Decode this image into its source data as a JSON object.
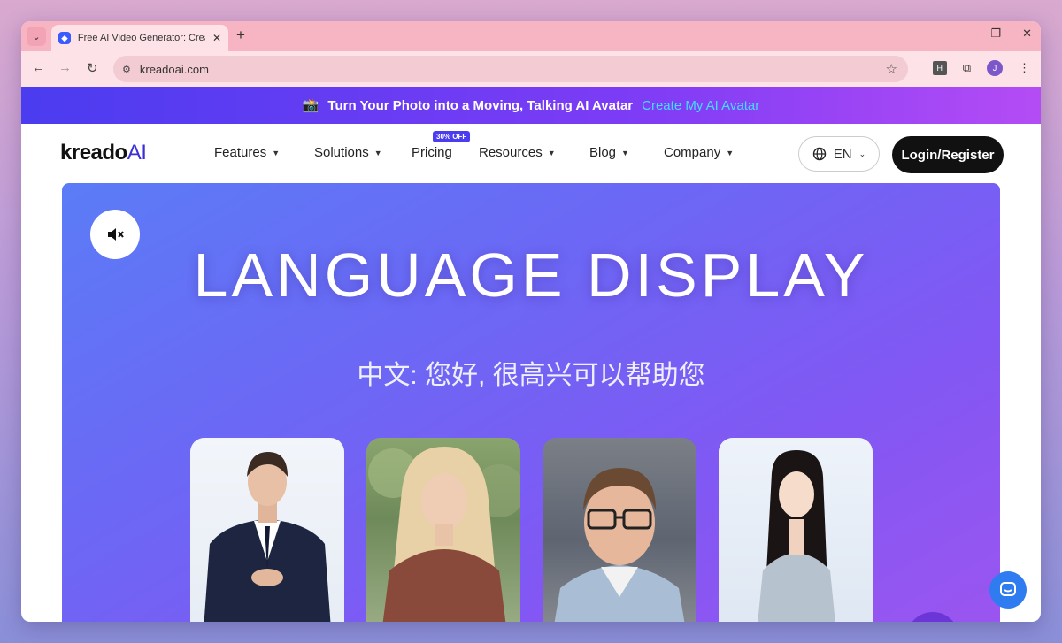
{
  "browser": {
    "tab_title": "Free AI Video Generator: Create",
    "favicon": "kreado-favicon",
    "url": "kreadoai.com",
    "profile_initial": "J",
    "ext_h": "H"
  },
  "banner": {
    "emoji": "📸",
    "text": "Turn Your Photo into a Moving, Talking AI Avatar",
    "link": "Create My AI Avatar"
  },
  "nav": {
    "logo_main": "kreado",
    "logo_ai": "AI",
    "items": [
      {
        "label": "Features",
        "dropdown": true
      },
      {
        "label": "Solutions",
        "dropdown": true
      },
      {
        "label": "Pricing",
        "dropdown": false,
        "badge": "30% OFF"
      },
      {
        "label": "Resources",
        "dropdown": true
      },
      {
        "label": "Blog",
        "dropdown": true
      },
      {
        "label": "Company",
        "dropdown": true
      }
    ],
    "language": "EN",
    "login": "Login/Register"
  },
  "hero": {
    "title": "LANGUAGE DISPLAY",
    "subtitle": "中文: 您好, 很高兴可以帮助您"
  },
  "colors": {
    "accent": "#4a3cf0",
    "banner_link": "#3ee0ff",
    "chat": "#2f7bf0"
  }
}
